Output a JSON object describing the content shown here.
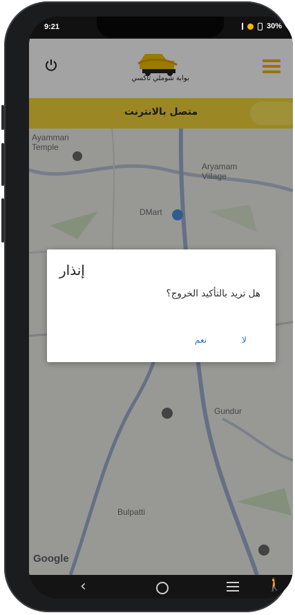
{
  "status_bar": {
    "time": "9:21",
    "battery": "30%"
  },
  "app": {
    "logo_text": "بوابة شوملي تاكسي",
    "connection_status": "متصل  بالانترنت"
  },
  "map": {
    "labels": [
      "Ayamman Temple",
      "Aryamam Village",
      "DMart",
      "Gundur",
      "Bulpatti"
    ],
    "attribution": "Google"
  },
  "dialog": {
    "title": "إنذار",
    "message": "هل تريد بالتأكيد الخروج؟",
    "yes_label": "نعم",
    "no_label": "لا"
  },
  "colors": {
    "accent": "#f4d43a",
    "menu": "#f0b600",
    "dialog_button": "#1e6fd9"
  }
}
